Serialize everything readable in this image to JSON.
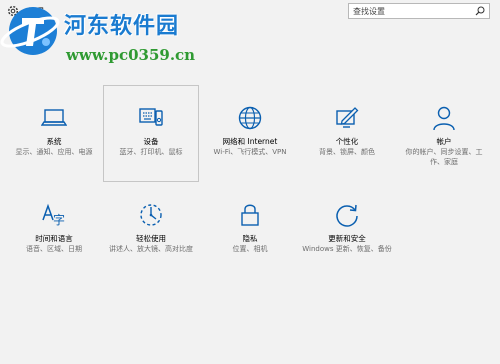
{
  "window": {
    "title": "设置"
  },
  "search": {
    "placeholder": "查找设置"
  },
  "watermark": {
    "name": "河东软件园",
    "url": "www.pc0359.cn"
  },
  "tiles": [
    {
      "label": "系统",
      "desc": "显示、通知、应用、电源",
      "icon": "laptop-icon"
    },
    {
      "label": "设备",
      "desc": "蓝牙、打印机、鼠标",
      "icon": "devices-icon"
    },
    {
      "label": "网络和 Internet",
      "desc": "Wi-Fi、飞行模式、VPN",
      "icon": "globe-icon"
    },
    {
      "label": "个性化",
      "desc": "背景、锁屏、颜色",
      "icon": "personalization-icon"
    },
    {
      "label": "帐户",
      "desc": "你的帐户、同步设置、工作、家庭",
      "icon": "person-icon"
    },
    {
      "label": "时间和语言",
      "desc": "语音、区域、日期",
      "icon": "time-language-icon"
    },
    {
      "label": "轻松使用",
      "desc": "讲述人、放大镜、高对比度",
      "icon": "ease-of-access-icon"
    },
    {
      "label": "隐私",
      "desc": "位置、相机",
      "icon": "lock-icon"
    },
    {
      "label": "更新和安全",
      "desc": "Windows 更新、恢复、备份",
      "icon": "update-icon"
    }
  ],
  "colors": {
    "icon": "#0a5fb0",
    "background": "#f2f2f2",
    "watermark_name": "#1a7bd0",
    "watermark_url": "#2f9a32"
  }
}
